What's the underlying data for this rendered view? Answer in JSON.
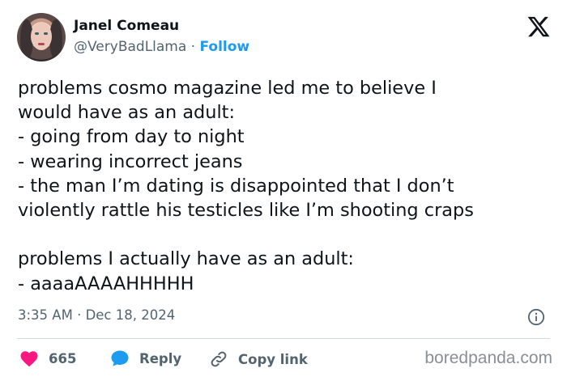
{
  "author": {
    "name": "Janel Comeau",
    "handle": "@VeryBadLlama",
    "separator": " · ",
    "follow_label": "Follow"
  },
  "tweet": {
    "text": "problems cosmo magazine led me to believe I\nwould have as an adult:\n- going from day to night\n- wearing incorrect jeans\n- the man I’m dating is disappointed that I don’t\nviolently rattle his testicles like I’m shooting craps\n\nproblems I actually have as an adult:\n- aaaaAAAAHHHHH",
    "time": "3:35 AM",
    "date_separator": " · ",
    "date": "Dec 18, 2024"
  },
  "actions": {
    "like_count": "665",
    "reply_label": "Reply",
    "copy_label": "Copy link"
  },
  "watermark": "boredpanda.com",
  "colors": {
    "accent": "#1d9bf0",
    "like": "#f91880",
    "secondary_text": "#536471",
    "text": "#0f1419"
  },
  "icons": [
    "x-logo-icon",
    "info-icon",
    "heart-icon",
    "reply-bubble-icon",
    "link-icon"
  ]
}
